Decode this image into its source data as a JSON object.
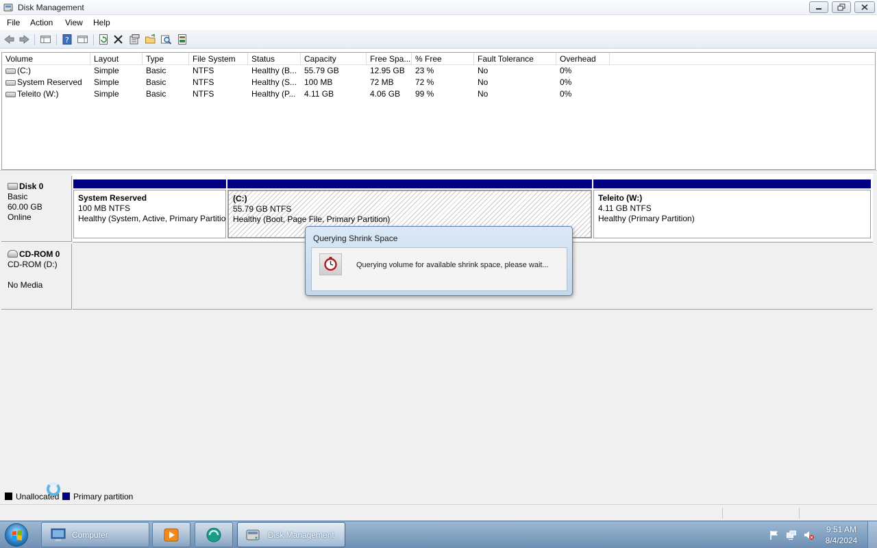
{
  "window": {
    "title": "Disk Management"
  },
  "menu": [
    "File",
    "Action",
    "View",
    "Help"
  ],
  "toolbar": {
    "icons": [
      "back-icon",
      "forward-icon",
      "show-hide-console-tree-icon",
      "help-icon",
      "properties-pane-icon",
      "refresh-icon",
      "delete-icon",
      "properties-icon",
      "open-icon",
      "explore-icon",
      "help-topics-icon"
    ]
  },
  "volume_list": {
    "columns": [
      "Volume",
      "Layout",
      "Type",
      "File System",
      "Status",
      "Capacity",
      "Free Spa...",
      "% Free",
      "Fault Tolerance",
      "Overhead"
    ],
    "rows": [
      {
        "volume": "(C:)",
        "layout": "Simple",
        "type": "Basic",
        "fs": "NTFS",
        "status": "Healthy (B...",
        "capacity": "55.79 GB",
        "free": "12.95 GB",
        "pct_free": "23 %",
        "fault": "No",
        "overhead": "0%"
      },
      {
        "volume": "System Reserved",
        "layout": "Simple",
        "type": "Basic",
        "fs": "NTFS",
        "status": "Healthy (S...",
        "capacity": "100 MB",
        "free": "72 MB",
        "pct_free": "72 %",
        "fault": "No",
        "overhead": "0%"
      },
      {
        "volume": "Teleito (W:)",
        "layout": "Simple",
        "type": "Basic",
        "fs": "NTFS",
        "status": "Healthy (P...",
        "capacity": "4.11 GB",
        "free": "4.06 GB",
        "pct_free": "99 %",
        "fault": "No",
        "overhead": "0%"
      }
    ]
  },
  "disks": [
    {
      "name": "Disk 0",
      "lines": [
        "Basic",
        "60.00 GB",
        "Online"
      ],
      "partitions": [
        {
          "name": "System Reserved",
          "size": "100 MB NTFS",
          "status": "Healthy (System, Active, Primary Partition)"
        },
        {
          "name": "(C:)",
          "size": "55.79 GB NTFS",
          "status": "Healthy (Boot, Page File, Primary Partition)"
        },
        {
          "name": "Teleito  (W:)",
          "size": "4.11 GB NTFS",
          "status": "Healthy (Primary Partition)"
        }
      ]
    },
    {
      "name": "CD-ROM 0",
      "lines": [
        "CD-ROM (D:)",
        "",
        "No Media"
      ]
    }
  ],
  "legend": [
    {
      "label": "Unallocated",
      "color": "#000000"
    },
    {
      "label": "Primary partition",
      "color": "#000080"
    }
  ],
  "dialog": {
    "title": "Querying Shrink Space",
    "message": "Querying volume for available shrink space, please wait..."
  },
  "taskbar": {
    "buttons": [
      {
        "label": "Computer",
        "icon": "computer-icon",
        "active": false
      },
      {
        "label": "",
        "icon": "media-player-icon",
        "active": false
      },
      {
        "label": "",
        "icon": "app-icon",
        "active": false
      },
      {
        "label": "Disk Management",
        "icon": "disk-management-icon",
        "active": true
      }
    ],
    "tray_icons": [
      "action-center-flag-icon",
      "network-icon",
      "volume-muted-icon"
    ],
    "clock": {
      "time": "9:51 AM",
      "date": "8/4/2024"
    }
  },
  "colors": {
    "primary_partition": "#000080",
    "unallocated": "#000000",
    "taskbar": "#7e9fc2"
  }
}
